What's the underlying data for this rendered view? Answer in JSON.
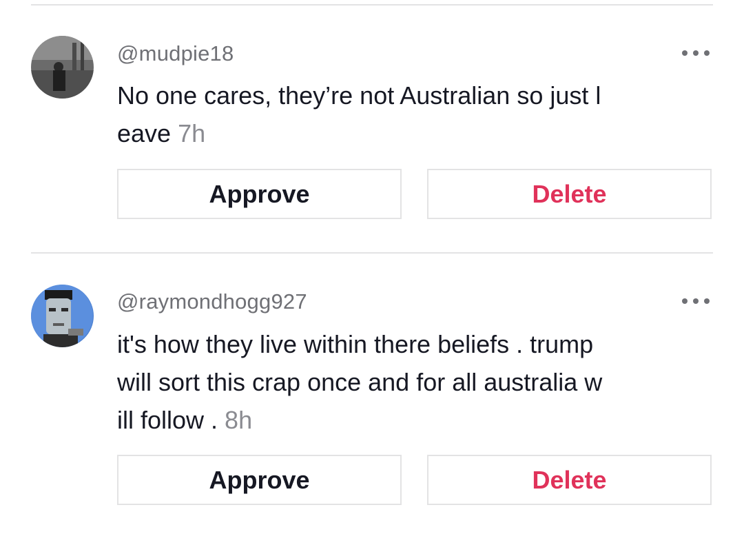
{
  "comments": [
    {
      "username": "@mudpie18",
      "text_lines": [
        "No one cares, they’re not Australian so just l",
        "eave "
      ],
      "time": "7h",
      "approve_label": "Approve",
      "delete_label": "Delete",
      "avatar_icon": "dark-figure-avatar"
    },
    {
      "username": "@raymondhogg927",
      "text_lines": [
        "it's how they live within there beliefs . trump",
        "will sort this crap once and for all australia w",
        "ill follow . "
      ],
      "time": "8h",
      "approve_label": "Approve",
      "delete_label": "Delete",
      "avatar_icon": "monster-face-avatar"
    }
  ],
  "colors": {
    "delete": "#e0325a",
    "username": "#6f7075",
    "divider": "#e3e3e4"
  }
}
